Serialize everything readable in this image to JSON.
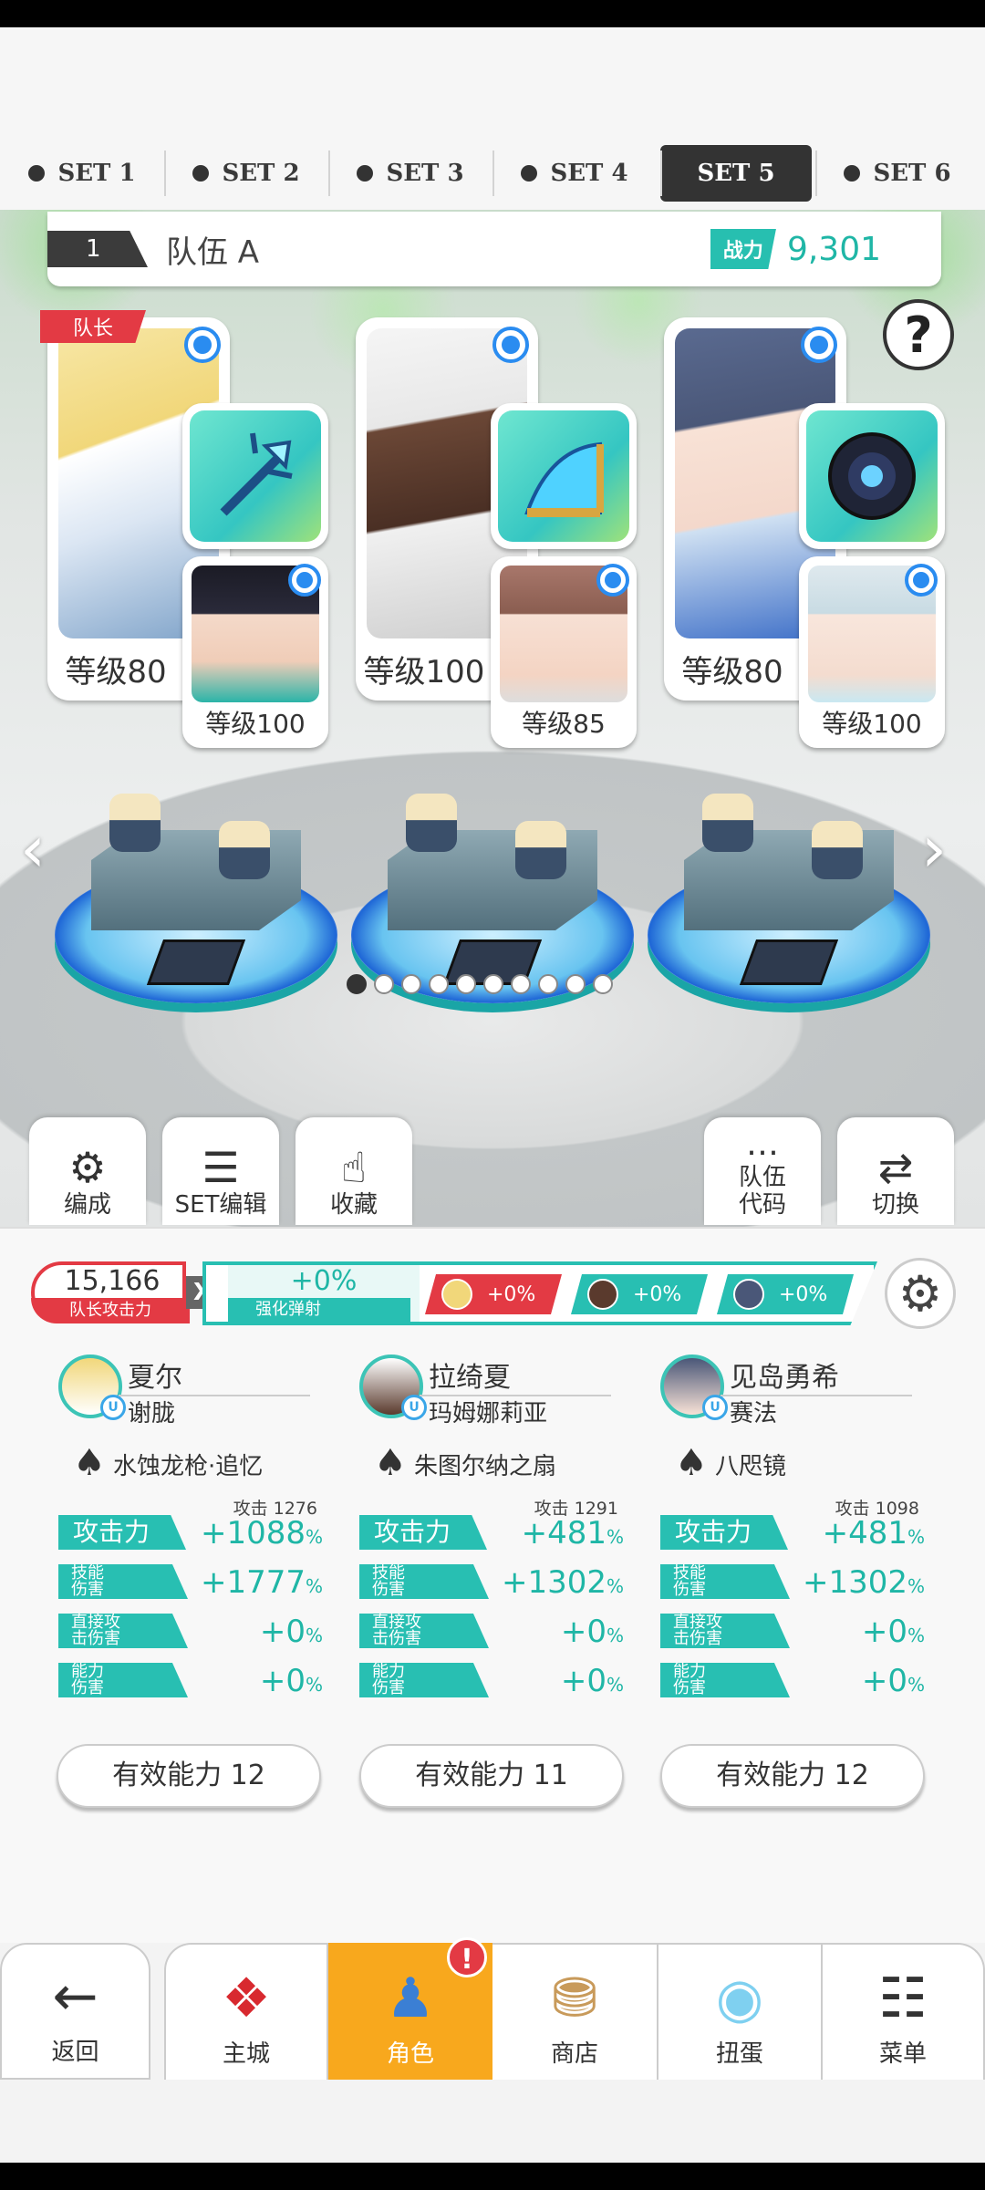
{
  "tabs": [
    {
      "label": "SET 1",
      "active": false
    },
    {
      "label": "SET 2",
      "active": false
    },
    {
      "label": "SET 3",
      "active": false
    },
    {
      "label": "SET 4",
      "active": false
    },
    {
      "label": "SET 5",
      "active": true
    },
    {
      "label": "SET 6",
      "active": false
    }
  ],
  "team": {
    "number": "1",
    "name": "队伍 A",
    "power_label": "战力",
    "power_value": "9,301"
  },
  "help_label": "?",
  "leader_tag": "队长",
  "slots": [
    {
      "main_level": "等级80",
      "sub_level": "等级100"
    },
    {
      "main_level": "等级100",
      "sub_level": "等级85"
    },
    {
      "main_level": "等级80",
      "sub_level": "等级100"
    }
  ],
  "actions": {
    "formation": "编成",
    "set_edit": "SET编辑",
    "favorite": "收藏",
    "team_code": "队伍\n代码",
    "switch": "切换"
  },
  "stats_bar": {
    "leader_attack_value": "15,166",
    "leader_attack_label": "队长攻击力",
    "x": "X",
    "bonus_value": "+0%",
    "bonus_label": "强化弹射",
    "chips": [
      "+0%",
      "+0%",
      "+0%"
    ]
  },
  "heroes": [
    {
      "name": "夏尔",
      "sub_name": "谢胧",
      "weapon": "水蚀龙枪·追忆",
      "attack_label": "攻击力",
      "attack_base": "攻击 1276",
      "attack_bonus": "+1088",
      "skill_label": "技能\n伤害",
      "skill_bonus": "+1777",
      "direct_label": "直接攻\n击伤害",
      "direct_bonus": "+0",
      "ability_label": "能力\n伤害",
      "ability_bonus": "+0",
      "effective": "有效能力 12"
    },
    {
      "name": "拉绮夏",
      "sub_name": "玛姆娜莉亚",
      "weapon": "朱图尔纳之扇",
      "attack_label": "攻击力",
      "attack_base": "攻击 1291",
      "attack_bonus": "+481",
      "skill_label": "技能\n伤害",
      "skill_bonus": "+1302",
      "direct_label": "直接攻\n击伤害",
      "direct_bonus": "+0",
      "ability_label": "能力\n伤害",
      "ability_bonus": "+0",
      "effective": "有效能力 11"
    },
    {
      "name": "见岛勇希",
      "sub_name": "赛法",
      "weapon": "八咫镜",
      "attack_label": "攻击力",
      "attack_base": "攻击 1098",
      "attack_bonus": "+481",
      "skill_label": "技能\n伤害",
      "skill_bonus": "+1302",
      "direct_label": "直接攻\n击伤害",
      "direct_bonus": "+0",
      "ability_label": "能力\n伤害",
      "ability_bonus": "+0",
      "effective": "有效能力 12"
    }
  ],
  "percent_sign": "%",
  "nav": [
    {
      "label": "返回"
    },
    {
      "label": "主城"
    },
    {
      "label": "角色",
      "active": true,
      "badge": "!"
    },
    {
      "label": "商店"
    },
    {
      "label": "扭蛋"
    },
    {
      "label": "菜单"
    }
  ],
  "pager": {
    "count": 10,
    "active_index": 0
  },
  "colors": {
    "accent": "#28bfb2",
    "leader": "#e33a44",
    "active_nav": "#f8a81d"
  }
}
